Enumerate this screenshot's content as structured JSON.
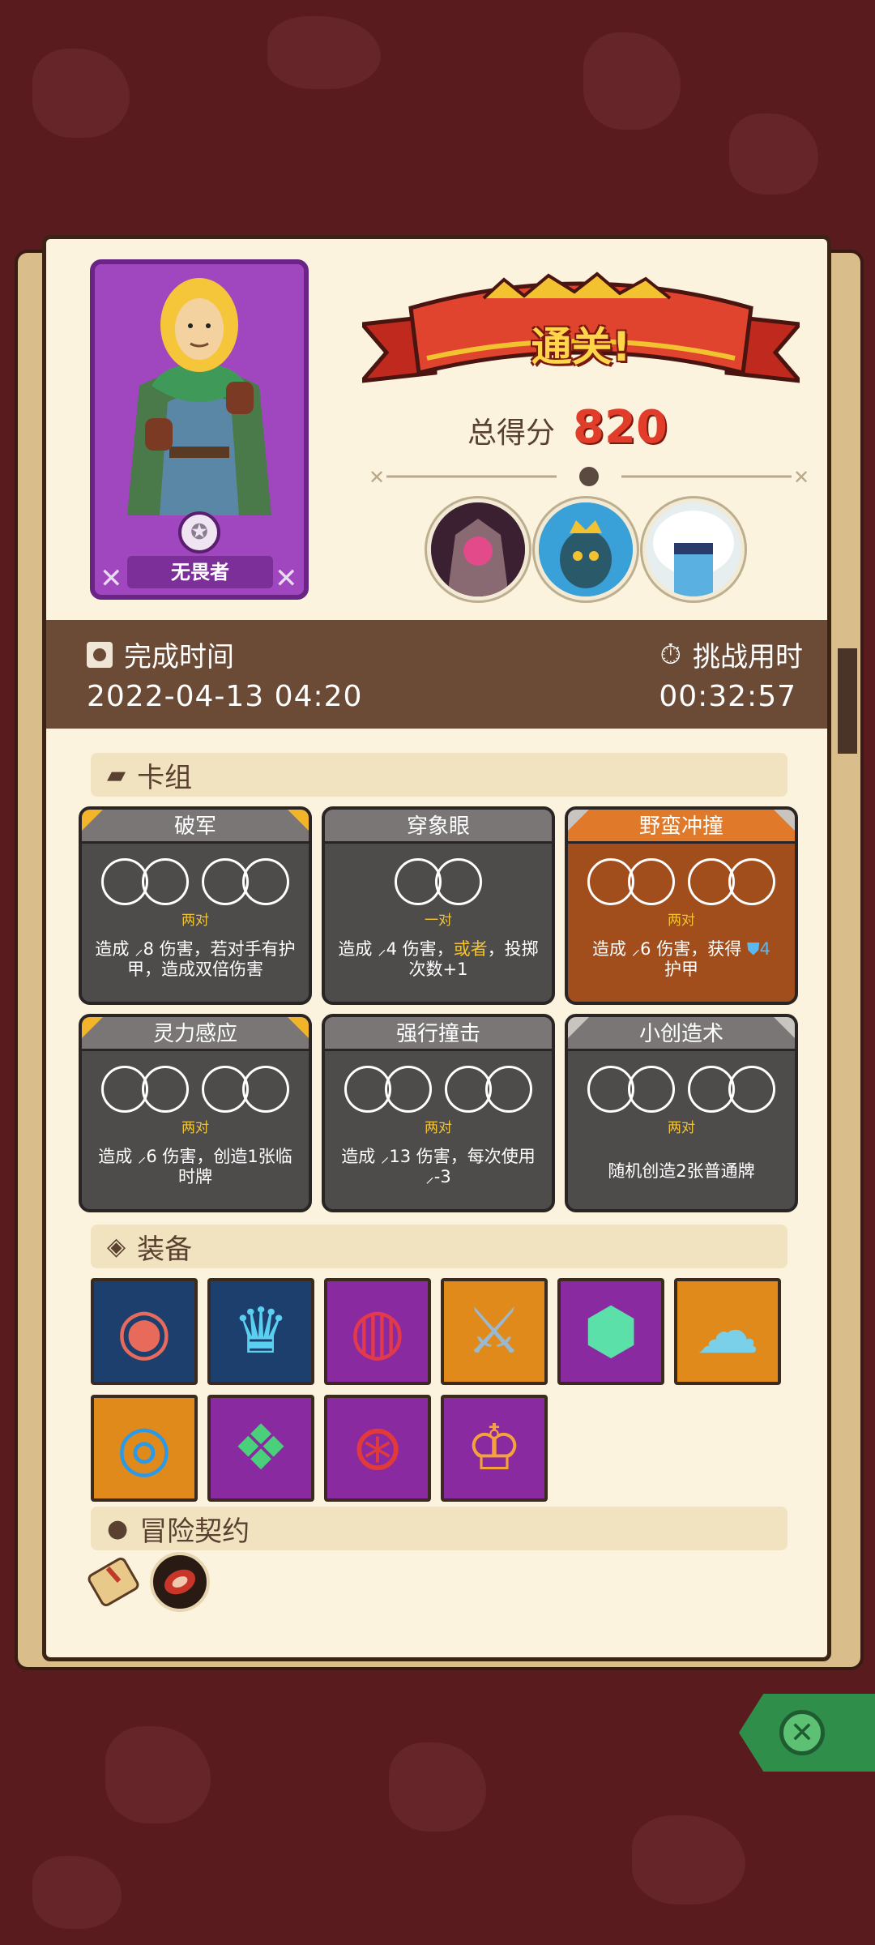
{
  "hero": {
    "name": "无畏者"
  },
  "result": {
    "banner": "通关!",
    "score_label": "总得分",
    "score_value": "820"
  },
  "bosses": [
    "boss-stone-golem",
    "boss-crowned-squid",
    "boss-yeti"
  ],
  "stats": {
    "finish_label": "完成时间",
    "finish_value": "2022-04-13  04:20",
    "duration_label": "挑战用时",
    "duration_value": "00:32:57"
  },
  "sections": {
    "deck": "卡组",
    "equipment": "装备",
    "contract": "冒险契约"
  },
  "cards": [
    {
      "title": "破军",
      "pairs": 2,
      "sub": "两对",
      "desc": "造成 ⸝8 伤害，若对手有护甲，造成双倍伤害",
      "style": "gray",
      "corners": "gold"
    },
    {
      "title": "穿象眼",
      "pairs": 1,
      "sub": "一对",
      "desc_a": "造成 ⸝4 伤害，",
      "desc_hl": "或者",
      "desc_b": "，投掷次数+1",
      "style": "gray",
      "corners": "none"
    },
    {
      "title": "野蛮冲撞",
      "pairs": 2,
      "sub": "两对",
      "desc_a": "造成 ⸝6 伤害，获得 ",
      "desc_hl": "⛊4",
      "desc_b": "护甲",
      "style": "orange",
      "corners": "silver"
    },
    {
      "title": "灵力感应",
      "pairs": 2,
      "sub": "两对",
      "desc": "造成 ⸝6 伤害，创造1张临时牌",
      "style": "gray",
      "corners": "gold"
    },
    {
      "title": "强行撞击",
      "pairs": 2,
      "sub": "两对",
      "desc": "造成 ⸝13 伤害，每次使用 ⸝-3",
      "style": "gray",
      "corners": "none"
    },
    {
      "title": "小创造术",
      "pairs": 2,
      "sub": "两对",
      "desc": "随机创造2张普通牌",
      "style": "gray",
      "corners": "silver"
    }
  ],
  "equipment": [
    {
      "icon": "round-shield-icon",
      "bg": "#1d3f6e"
    },
    {
      "icon": "ice-crown-icon",
      "bg": "#1d3f6e"
    },
    {
      "icon": "emerald-bracer-icon",
      "bg": "#8a2aa0"
    },
    {
      "icon": "broken-sword-icon",
      "bg": "#e08a1c"
    },
    {
      "icon": "crystal-d20-icon",
      "bg": "#8a2aa0"
    },
    {
      "icon": "ghost-slime-icon",
      "bg": "#e08a1c"
    },
    {
      "icon": "spiral-orb-icon",
      "bg": "#e08a1c"
    },
    {
      "icon": "green-gem-icon",
      "bg": "#8a2aa0"
    },
    {
      "icon": "spiked-ring-icon",
      "bg": "#8a2aa0"
    },
    {
      "icon": "golden-crown-icon",
      "bg": "#8a2aa0"
    }
  ],
  "contracts": [
    "scroll-icon",
    "meat-icon"
  ]
}
